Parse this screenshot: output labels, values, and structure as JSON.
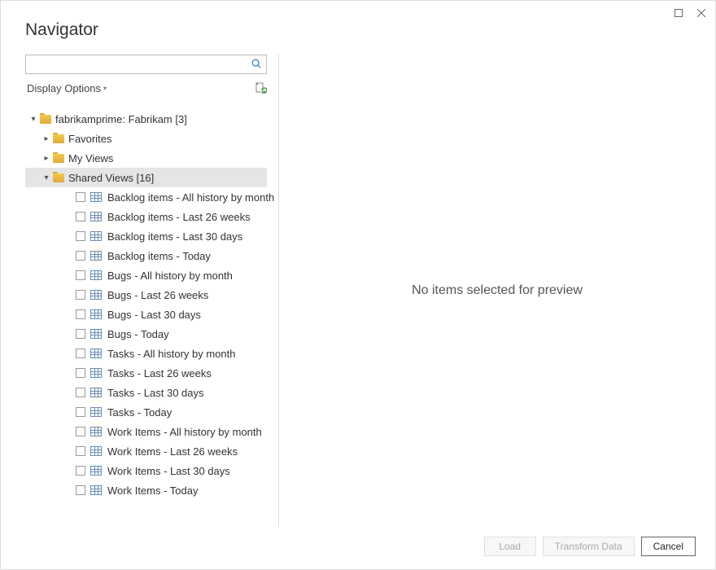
{
  "title": "Navigator",
  "search": {
    "placeholder": ""
  },
  "display_options_label": "Display Options",
  "tree": {
    "root": {
      "label": "fabrikamprime: Fabrikam [3]",
      "expanded": true
    },
    "children": [
      {
        "label": "Favorites",
        "expanded": false,
        "selected": false
      },
      {
        "label": "My Views",
        "expanded": false,
        "selected": false
      },
      {
        "label": "Shared Views [16]",
        "expanded": true,
        "selected": true
      }
    ],
    "leaves": [
      {
        "label": "Backlog items - All history by month"
      },
      {
        "label": "Backlog items - Last 26 weeks"
      },
      {
        "label": "Backlog items - Last 30 days"
      },
      {
        "label": "Backlog items - Today"
      },
      {
        "label": "Bugs - All history by month"
      },
      {
        "label": "Bugs - Last 26 weeks"
      },
      {
        "label": "Bugs - Last 30 days"
      },
      {
        "label": "Bugs - Today"
      },
      {
        "label": "Tasks - All history by month"
      },
      {
        "label": "Tasks - Last 26 weeks"
      },
      {
        "label": "Tasks - Last 30 days"
      },
      {
        "label": "Tasks - Today"
      },
      {
        "label": "Work Items - All history by month"
      },
      {
        "label": "Work Items - Last 26 weeks"
      },
      {
        "label": "Work Items - Last 30 days"
      },
      {
        "label": "Work Items - Today"
      }
    ]
  },
  "preview_empty_text": "No items selected for preview",
  "footer": {
    "load": "Load",
    "transform": "Transform Data",
    "cancel": "Cancel"
  }
}
